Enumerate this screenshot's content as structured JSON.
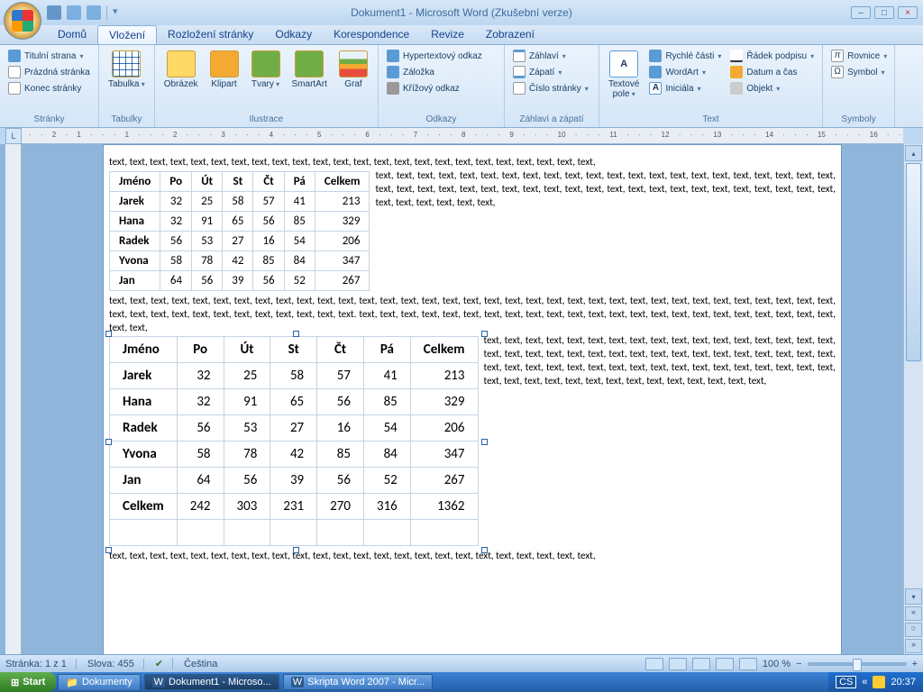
{
  "app": {
    "title": "Dokument1 - Microsoft Word (Zkušební verze)"
  },
  "tabs": {
    "home": "Domů",
    "insert": "Vložení",
    "layout": "Rozložení stránky",
    "refs": "Odkazy",
    "mail": "Korespondence",
    "review": "Revize",
    "view": "Zobrazení"
  },
  "ribbon": {
    "pages": {
      "title": "Stránky",
      "cover": "Titulní strana",
      "blank": "Prázdná stránka",
      "break": "Konec stránky"
    },
    "tables": {
      "title": "Tabulky",
      "table": "Tabulka"
    },
    "illustrations": {
      "title": "Ilustrace",
      "picture": "Obrázek",
      "clipart": "Klipart",
      "shapes": "Tvary",
      "smartart": "SmartArt",
      "chart": "Graf"
    },
    "links": {
      "title": "Odkazy",
      "hyper": "Hypertextový odkaz",
      "bookmark": "Záložka",
      "crossref": "Křížový odkaz"
    },
    "headerfooter": {
      "title": "Záhlaví a zápatí",
      "header": "Záhlaví",
      "footer": "Zápatí",
      "pagenum": "Číslo stránky"
    },
    "text": {
      "title": "Text",
      "textbox": "Textové\npole",
      "quick": "Rychlé části",
      "wordart": "WordArt",
      "dropcap": "Iniciála",
      "sigline": "Řádek podpisu",
      "datetime": "Datum a čas",
      "object": "Objekt"
    },
    "symbols": {
      "title": "Symboly",
      "equation": "Rovnice",
      "symbol": "Symbol"
    }
  },
  "chart_data": [
    {
      "type": "table",
      "title": "Table 1 (top, no totals row)",
      "headers": [
        "Jméno",
        "Po",
        "Út",
        "St",
        "Čt",
        "Pá",
        "Celkem"
      ],
      "rows": [
        [
          "Jarek",
          32,
          25,
          58,
          57,
          41,
          213
        ],
        [
          "Hana",
          32,
          91,
          65,
          56,
          85,
          329
        ],
        [
          "Radek",
          56,
          53,
          27,
          16,
          54,
          206
        ],
        [
          "Yvona",
          58,
          78,
          42,
          85,
          84,
          347
        ],
        [
          "Jan",
          64,
          56,
          39,
          56,
          52,
          267
        ]
      ]
    },
    {
      "type": "table",
      "title": "Table 2 (bottom, selected, with totals)",
      "headers": [
        "Jméno",
        "Po",
        "Út",
        "St",
        "Čt",
        "Pá",
        "Celkem"
      ],
      "rows": [
        [
          "Jarek",
          32,
          25,
          58,
          57,
          41,
          213
        ],
        [
          "Hana",
          32,
          91,
          65,
          56,
          85,
          329
        ],
        [
          "Radek",
          56,
          53,
          27,
          16,
          54,
          206
        ],
        [
          "Yvona",
          58,
          78,
          42,
          85,
          84,
          347
        ],
        [
          "Jan",
          64,
          56,
          39,
          56,
          52,
          267
        ],
        [
          "Celkem",
          242,
          303,
          231,
          270,
          316,
          1362
        ]
      ]
    }
  ],
  "filler": "text, text, text, text, text, text, text, text, text, text, text, text, text, text, text, text, text, text, text, text, text, text, text, text,",
  "filler_short": "text, text, text, text, text,",
  "filler_end": "text, text, text, text, text, text, text, text, text, text, text, text, text, text, text, text, text, text, text, text, text, text, text. text,",
  "status": {
    "page": "Stránka: 1 z 1",
    "words": "Slova: 455",
    "lang": "Čeština",
    "zoom": "100 %"
  },
  "taskbar": {
    "start": "Start",
    "t1": "Dokumenty",
    "t2": "Dokument1 - Microso...",
    "t3": "Skripta Word 2007 - Micr...",
    "lang": "CS",
    "clock": "20:37"
  }
}
